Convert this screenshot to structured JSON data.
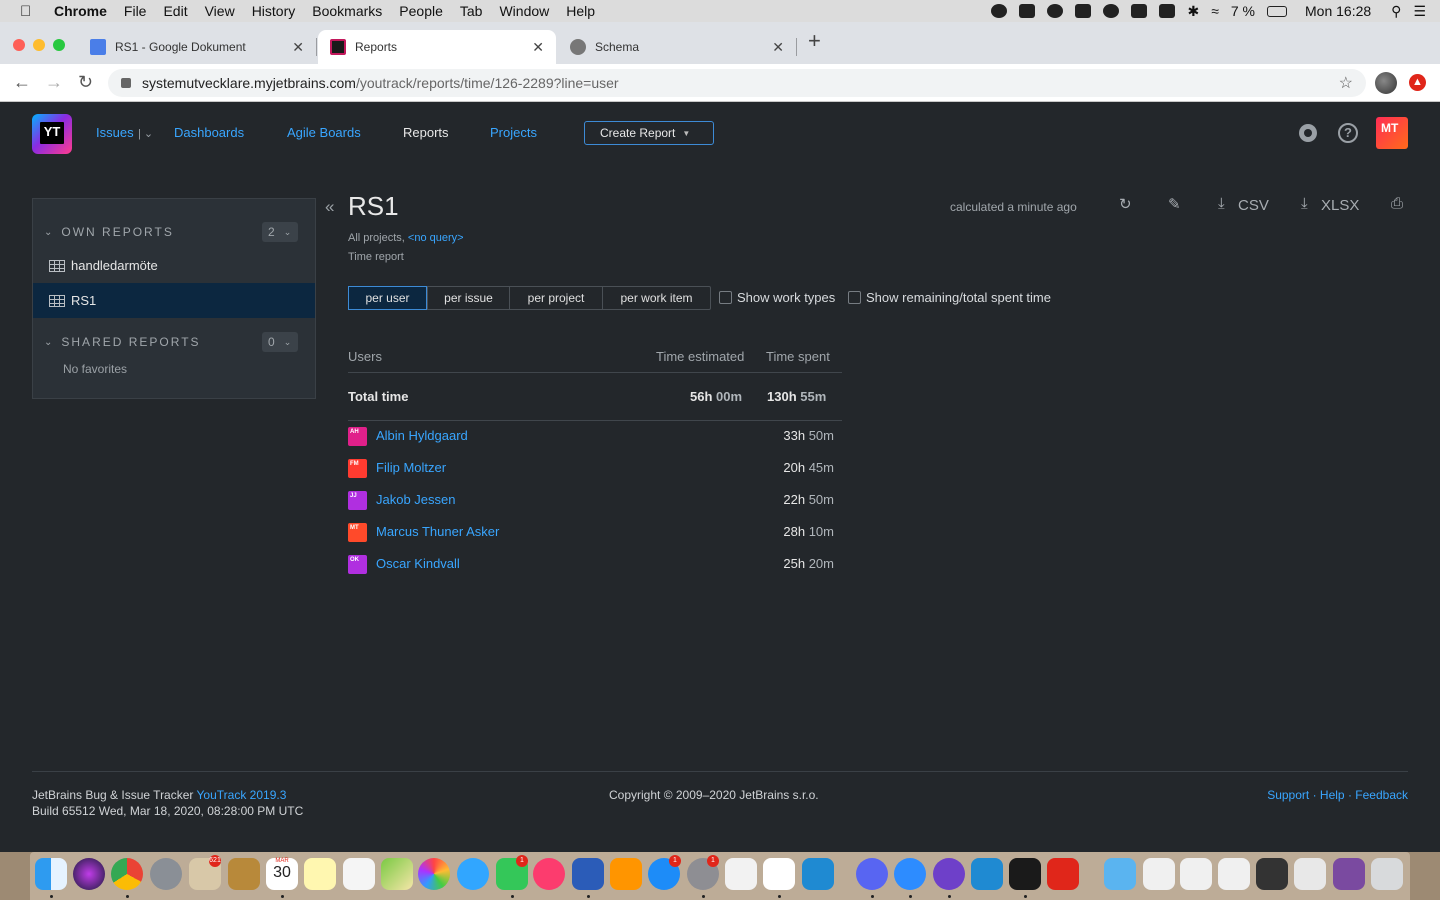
{
  "menubar": {
    "app": "Chrome",
    "items": [
      "File",
      "Edit",
      "View",
      "History",
      "Bookmarks",
      "People",
      "Tab",
      "Window",
      "Help"
    ],
    "battery": "7 %",
    "clock": "Mon 16:28"
  },
  "tabs": [
    {
      "title": "RS1 - Google Dokument",
      "favicon_color": "#4a7ee8"
    },
    {
      "title": "Reports",
      "favicon_color": "#1a1a1a"
    },
    {
      "title": "Schema",
      "favicon_color": "#666666"
    }
  ],
  "address": {
    "host": "systemutvecklare.myjetbrains.com",
    "path": "/youtrack/reports/time/126-2289?line=user"
  },
  "yt": {
    "logo_text": "YT",
    "nav": {
      "issues": "Issues",
      "dashboards": "Dashboards",
      "agile": "Agile Boards",
      "reports": "Reports",
      "projects": "Projects",
      "create_report": "Create Report"
    },
    "user_initials": "MT",
    "accent": "#39a6ff"
  },
  "sidebar": {
    "own_title": "OWN REPORTS",
    "own_count": "2",
    "own_items": [
      "handledarmöte",
      "RS1"
    ],
    "shared_title": "SHARED REPORTS",
    "shared_count": "0",
    "shared_empty": "No favorites"
  },
  "report": {
    "title": "RS1",
    "calculated": "calculated a minute ago",
    "csv": "CSV",
    "xlsx": "XLSX",
    "projects_label": "All projects,",
    "query": "<no query>",
    "type": "Time report",
    "groupings": [
      "per user",
      "per issue",
      "per project",
      "per work item"
    ],
    "active_grouping": "per user",
    "show_work_types": "Show work types",
    "show_remaining": "Show remaining/total spent time",
    "columns": {
      "users": "Users",
      "estimated": "Time estimated",
      "spent": "Time spent"
    },
    "total": {
      "label": "Total time",
      "estimated_h": "56h",
      "estimated_m": "00m",
      "spent_h": "130h",
      "spent_m": "55m"
    },
    "users": [
      {
        "initials": "AH",
        "name": "Albin Hyldgaard",
        "spent_h": "33h",
        "spent_m": "50m",
        "color": "#e0208a"
      },
      {
        "initials": "FM",
        "name": "Filip Moltzer",
        "spent_h": "20h",
        "spent_m": "45m",
        "color": "#ff3b30"
      },
      {
        "initials": "JJ",
        "name": "Jakob Jessen",
        "spent_h": "22h",
        "spent_m": "50m",
        "color": "#b02fe0"
      },
      {
        "initials": "MT",
        "name": "Marcus Thuner Asker",
        "spent_h": "28h",
        "spent_m": "10m",
        "color": "#ff4a2a"
      },
      {
        "initials": "OK",
        "name": "Oscar Kindvall",
        "spent_h": "25h",
        "spent_m": "20m",
        "color": "#b02fe0"
      }
    ]
  },
  "footer": {
    "tracker": "JetBrains Bug & Issue Tracker",
    "version": "YouTrack 2019.3",
    "build": "Build 65512 Wed, Mar 18, 2020, 08:28:00 PM UTC",
    "copyright": "Copyright © 2009–2020 JetBrains s.r.o.",
    "support": "Support",
    "help": "Help",
    "feedback": "Feedback",
    "dot": "·"
  },
  "dock": {
    "calendar_month": "MAR",
    "calendar_day": "30",
    "mail_badge": "621",
    "facetime_badge": "1",
    "appstore_badge": "1",
    "prefs_badge": "1"
  }
}
